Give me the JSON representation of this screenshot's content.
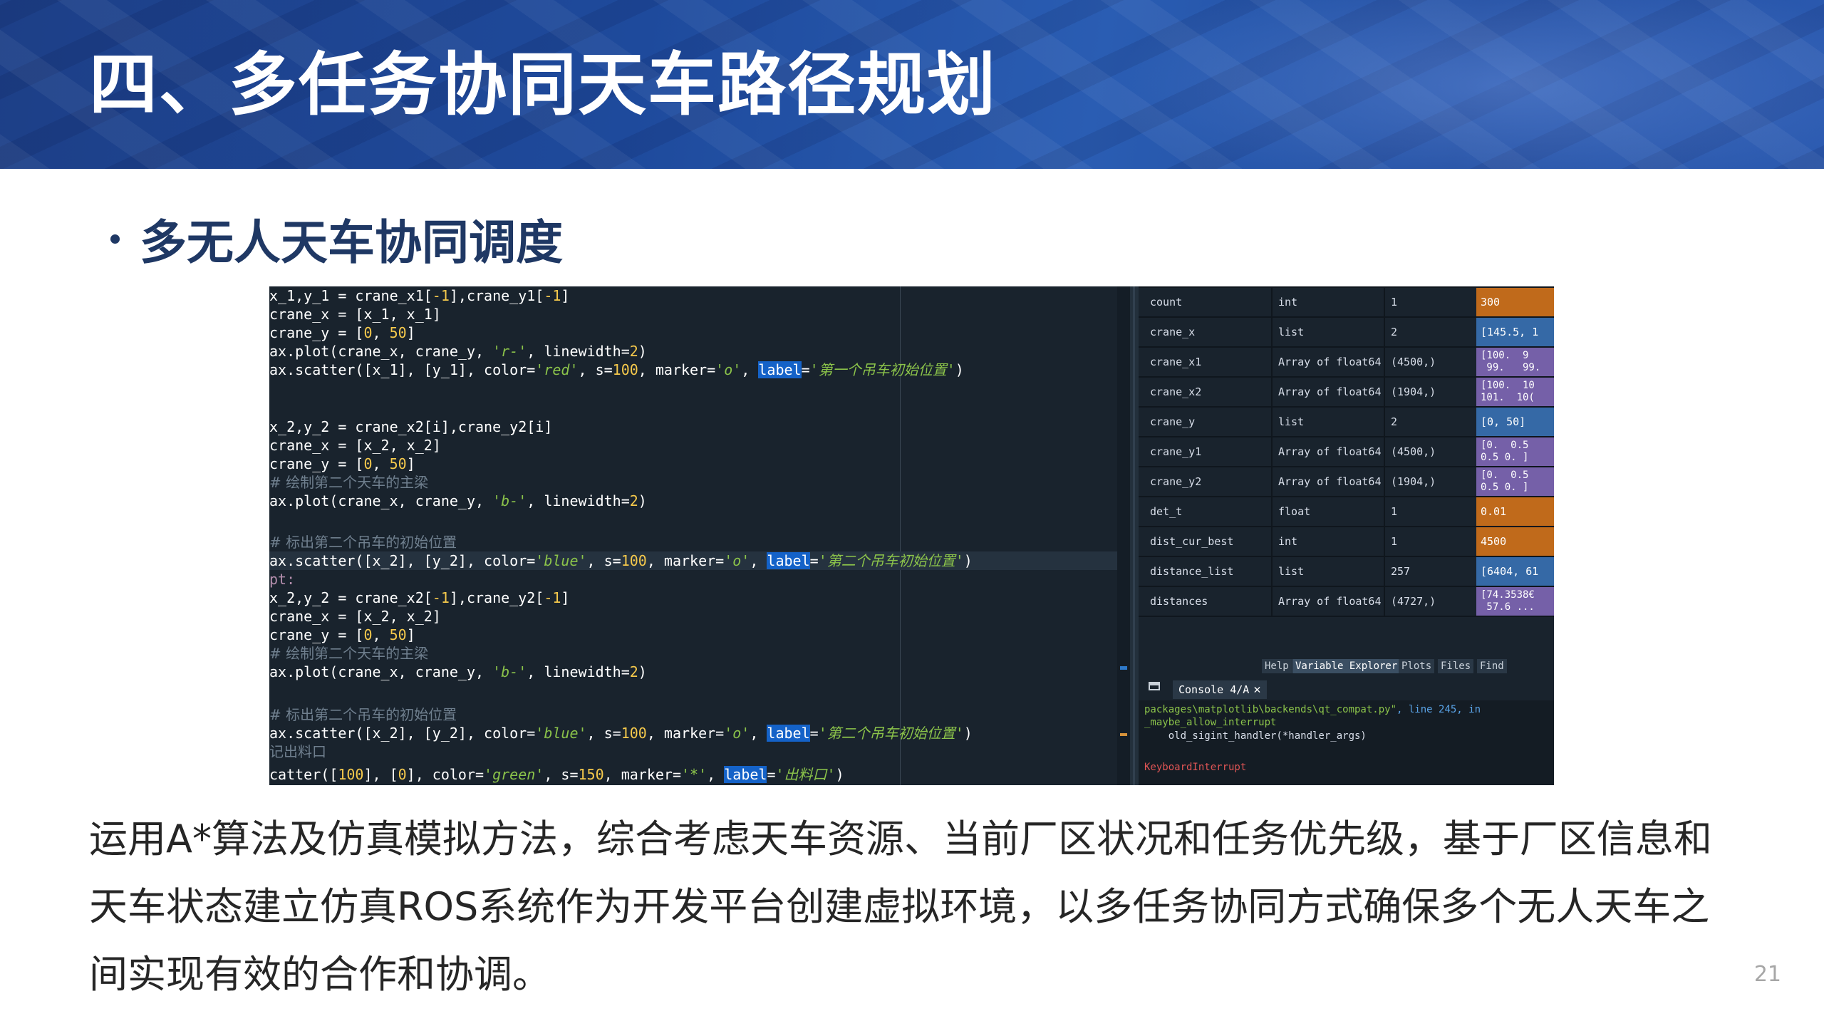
{
  "header": {
    "title": "四、多任务协同天车路径规划"
  },
  "section": {
    "bullet": "多无人天车协同调度"
  },
  "code": {
    "lines": [
      "x_1,y_1 = crane_x1[-1],crane_y1[-1]",
      "crane_x = [x_1, x_1]",
      "crane_y = [0, 50]",
      "ax.plot(crane_x, crane_y, 'r-', linewidth=2)",
      "ax.scatter([x_1], [y_1], color='red', s=100, marker='o', label='第一个吊车初始位置')",
      "x_2,y_2 = crane_x2[i],crane_y2[i]",
      "crane_x = [x_2, x_2]",
      "crane_y = [0, 50]",
      "# 绘制第二个天车的主梁",
      "ax.plot(crane_x, crane_y, 'b-', linewidth=2)",
      "# 标出第二个吊车的初始位置",
      "ax.scatter([x_2], [y_2], color='blue', s=100, marker='o', label='第二个吊车初始位置')",
      "pt:",
      "x_2,y_2 = crane_x2[-1],crane_y2[-1]",
      "crane_x = [x_2, x_2]",
      "crane_y = [0, 50]",
      "# 绘制第二个天车的主梁",
      "ax.plot(crane_x, crane_y, 'b-', linewidth=2)",
      "# 标出第二个吊车的初始位置",
      "ax.scatter([x_2], [y_2], color='blue', s=100, marker='o', label='第二个吊车初始位置')",
      "记出料口",
      "catter([100], [0], color='green', s=150, marker='*', label='出料口')"
    ]
  },
  "variables": {
    "rows": [
      {
        "name": "count",
        "type": "int",
        "size": "1",
        "value": "300",
        "color": "orange"
      },
      {
        "name": "crane_x",
        "type": "list",
        "size": "2",
        "value": "[145.5, 1",
        "color": "blue"
      },
      {
        "name": "crane_x1",
        "type": "Array of float64",
        "size": "(4500,)",
        "value": "[100.  9\n 99.   99.",
        "color": "purple"
      },
      {
        "name": "crane_x2",
        "type": "Array of float64",
        "size": "(1904,)",
        "value": "[100.  10\n101.  10(",
        "color": "purple"
      },
      {
        "name": "crane_y",
        "type": "list",
        "size": "2",
        "value": "[0, 50]",
        "color": "blue"
      },
      {
        "name": "crane_y1",
        "type": "Array of float64",
        "size": "(4500,)",
        "value": "[0.  0.5\n0.5 0. ]",
        "color": "purple"
      },
      {
        "name": "crane_y2",
        "type": "Array of float64",
        "size": "(1904,)",
        "value": "[0.  0.5\n0.5 0. ]",
        "color": "purple"
      },
      {
        "name": "det_t",
        "type": "float",
        "size": "1",
        "value": "0.01",
        "color": "orange"
      },
      {
        "name": "dist_cur_best",
        "type": "int",
        "size": "1",
        "value": "4500",
        "color": "orange"
      },
      {
        "name": "distance_list",
        "type": "list",
        "size": "257",
        "value": "[6404, 61",
        "color": "blue"
      },
      {
        "name": "distances",
        "type": "Array of float64",
        "size": "(4727,)",
        "value": "[74.3538€\n 57.6 ...",
        "color": "purple"
      }
    ]
  },
  "tabs": [
    "Help",
    "Variable Explorer",
    "Plots",
    "Files",
    "Find"
  ],
  "console": {
    "tab_label": "Console 4/A",
    "close_glyph": "✕",
    "line1": "packages\\matplotlib\\backends\\qt_compat.py\"",
    "line1_b": ", line 245, in",
    "line2": "_maybe_allow_interrupt",
    "line3": "    old_sigint_handler(*handler_args)",
    "line4": "KeyboardInterrupt"
  },
  "body_text": {
    "line1": "运用A*算法及仿真模拟方法，综合考虑天车资源、当前厂区状况和任务优先级，基于厂区信息和",
    "line2": "天车状态建立仿真ROS系统作为开发平台创建虚拟环境，以多任务协同方式确保多个无人天车之",
    "line3": "间实现有效的合作和协调。"
  },
  "page_number": "21"
}
